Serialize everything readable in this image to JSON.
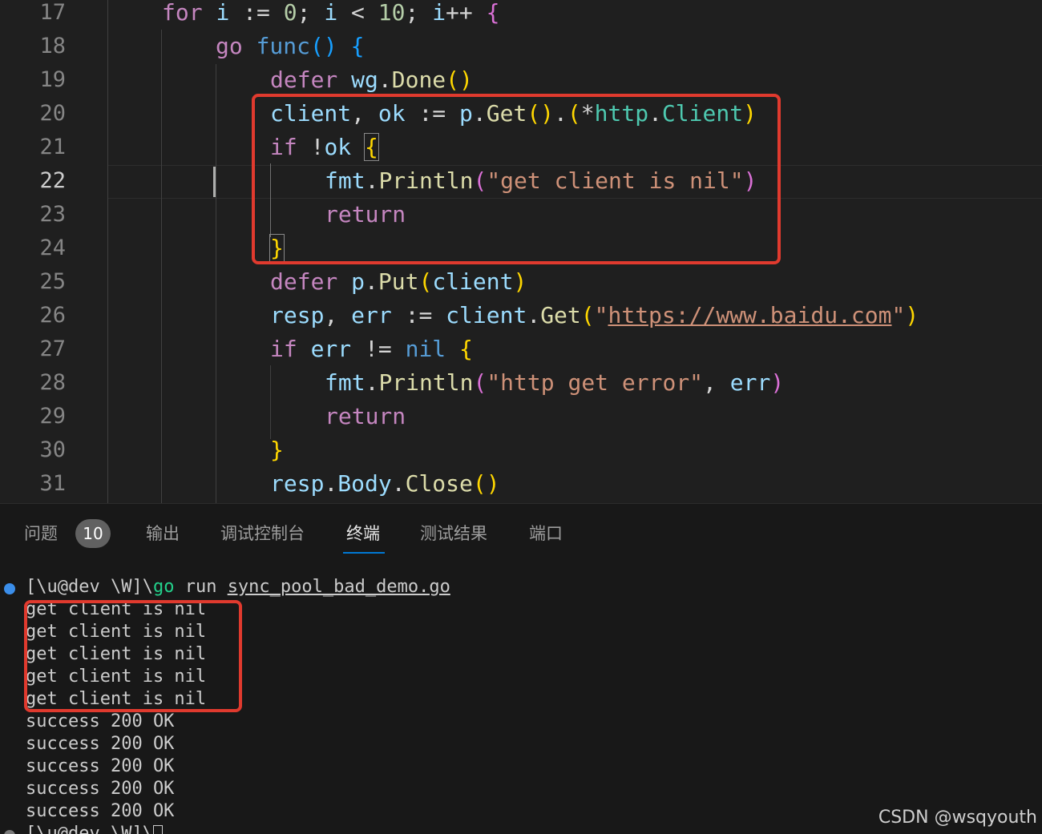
{
  "editor": {
    "line_numbers": [
      "17",
      "18",
      "19",
      "20",
      "21",
      "22",
      "23",
      "24",
      "25",
      "26",
      "27",
      "28",
      "29",
      "30",
      "31"
    ],
    "active_line": "22",
    "lines": {
      "l17": {
        "kw_for": "for",
        "v_i1": "i",
        "op1": " := ",
        "n0": "0",
        "op2": "; ",
        "v_i2": "i",
        "op3": " < ",
        "n10": "10",
        "op4": "; ",
        "v_i3": "i",
        "op5": "++ ",
        "br": "{"
      },
      "l18": {
        "kw_go": "go",
        "sp": " ",
        "kw_func": "func",
        "br1": "()",
        "sp2": " ",
        "br2": "{"
      },
      "l19": {
        "kw_defer": "defer",
        "sp": " ",
        "v_wg": "wg",
        "dot": ".",
        "fn_done": "Done",
        "br": "()"
      },
      "l20": {
        "v_client": "client",
        "comma": ", ",
        "v_ok": "ok",
        "op": " := ",
        "v_p": "p",
        "dot": ".",
        "fn_get": "Get",
        "br1": "()",
        "dot2": ".",
        "br2o": "(",
        "star": "*",
        "v_http": "http",
        "dot3": ".",
        "ty_client": "Client",
        "br2c": ")"
      },
      "l21": {
        "kw_if": "if",
        "sp": " ",
        "op_not": "!",
        "v_ok": "ok",
        "sp2": " ",
        "br": "{"
      },
      "l22": {
        "v_fmt": "fmt",
        "dot": ".",
        "fn_println": "Println",
        "bro": "(",
        "str": "\"get client is nil\"",
        "brc": ")"
      },
      "l23": {
        "kw_return": "return"
      },
      "l24": {
        "br": "}"
      },
      "l25": {
        "kw_defer": "defer",
        "sp": " ",
        "v_p": "p",
        "dot": ".",
        "fn_put": "Put",
        "bro": "(",
        "v_client": "client",
        "brc": ")"
      },
      "l26": {
        "v_resp": "resp",
        "comma": ", ",
        "v_err": "err",
        "op": " := ",
        "v_client": "client",
        "dot": ".",
        "fn_get": "Get",
        "bro": "(",
        "q1": "\"",
        "url": "https://www.baidu.com",
        "q2": "\"",
        "brc": ")"
      },
      "l27": {
        "kw_if": "if",
        "sp": " ",
        "v_err": "err",
        "op": " != ",
        "kb_nil": "nil",
        "sp2": " ",
        "br": "{"
      },
      "l28": {
        "v_fmt": "fmt",
        "dot": ".",
        "fn_println": "Println",
        "bro": "(",
        "str": "\"http get error\"",
        "comma": ", ",
        "v_err": "err",
        "brc": ")"
      },
      "l29": {
        "kw_return": "return"
      },
      "l30": {
        "br": "}"
      },
      "l31": {
        "v_resp": "resp",
        "dot": ".",
        "v_body": "Body",
        "dot2": ".",
        "fn_close": "Close",
        "br": "()"
      }
    }
  },
  "panel": {
    "tabs": [
      {
        "label": "问题"
      },
      {
        "label": "输出"
      },
      {
        "label": "调试控制台"
      },
      {
        "label": "终端"
      },
      {
        "label": "测试结果"
      },
      {
        "label": "端口"
      }
    ],
    "problems_count": "10",
    "active_tab": "终端",
    "terminal": {
      "prompt": "[\\u@dev \\W]\\",
      "cmd_go": "go",
      "cmd_run": " run ",
      "cmd_file": "sync_pool_bad_demo.go",
      "output": [
        "get client is nil",
        "get client is nil",
        "get client is nil",
        "get client is nil",
        "get client is nil",
        "success 200 OK",
        "success 200 OK",
        "success 200 OK",
        "success 200 OK",
        "success 200 OK"
      ],
      "last_prompt": "[\\u@dev \\W]\\"
    }
  },
  "watermark": "CSDN @wsqyouth",
  "colors": {
    "highlight_box": "#e03a2e",
    "tab_underline": "#0078d4",
    "keyword": "#c586c0",
    "string": "#ce9178",
    "function": "#dcdcaa",
    "type": "#4ec9b0",
    "variable": "#9cdcfe"
  }
}
